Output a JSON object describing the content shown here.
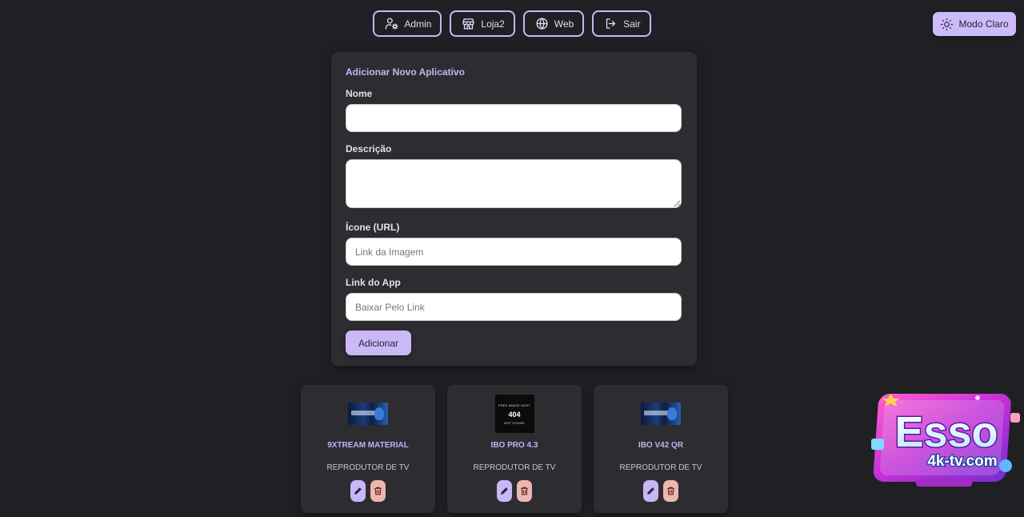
{
  "nav": {
    "items": [
      {
        "label": "Admin",
        "icon": "user-gear-icon"
      },
      {
        "label": "Loja2",
        "icon": "store-icon"
      },
      {
        "label": "Web",
        "icon": "globe-icon"
      },
      {
        "label": "Sair",
        "icon": "logout-icon"
      }
    ]
  },
  "theme_toggle": {
    "label": "Modo Claro",
    "icon": "sun-icon"
  },
  "form": {
    "title": "Adicionar Novo Aplicativo",
    "name_label": "Nome",
    "name_value": "",
    "description_label": "Descrição",
    "description_value": "",
    "icon_label": "Ícone (URL)",
    "icon_placeholder": "Link da Imagem",
    "link_label": "Link do App",
    "link_placeholder": "Baixar Pelo Link",
    "submit_label": "Adicionar"
  },
  "apps": [
    {
      "name": "9XTREAM MATERIAL",
      "description": "REPRODUTOR DE TV",
      "thumb": "banner"
    },
    {
      "name": "IBO PRO 4.3",
      "description": "REPRODUTOR DE TV",
      "thumb": "not-found",
      "thumb_text": {
        "top": "FREE IMAGE HOST",
        "code": "404",
        "bottom": "NOT FOUND"
      }
    },
    {
      "name": "IBO V42 QR",
      "description": "REPRODUTOR DE TV",
      "thumb": "banner"
    }
  ],
  "logo": {
    "text_main": "Esso",
    "text_sub": "4k-tv.com"
  },
  "colors": {
    "background": "#202024",
    "card": "#2d2d31",
    "accent": "#cbb8f7",
    "delete": "#eeb6b0"
  }
}
